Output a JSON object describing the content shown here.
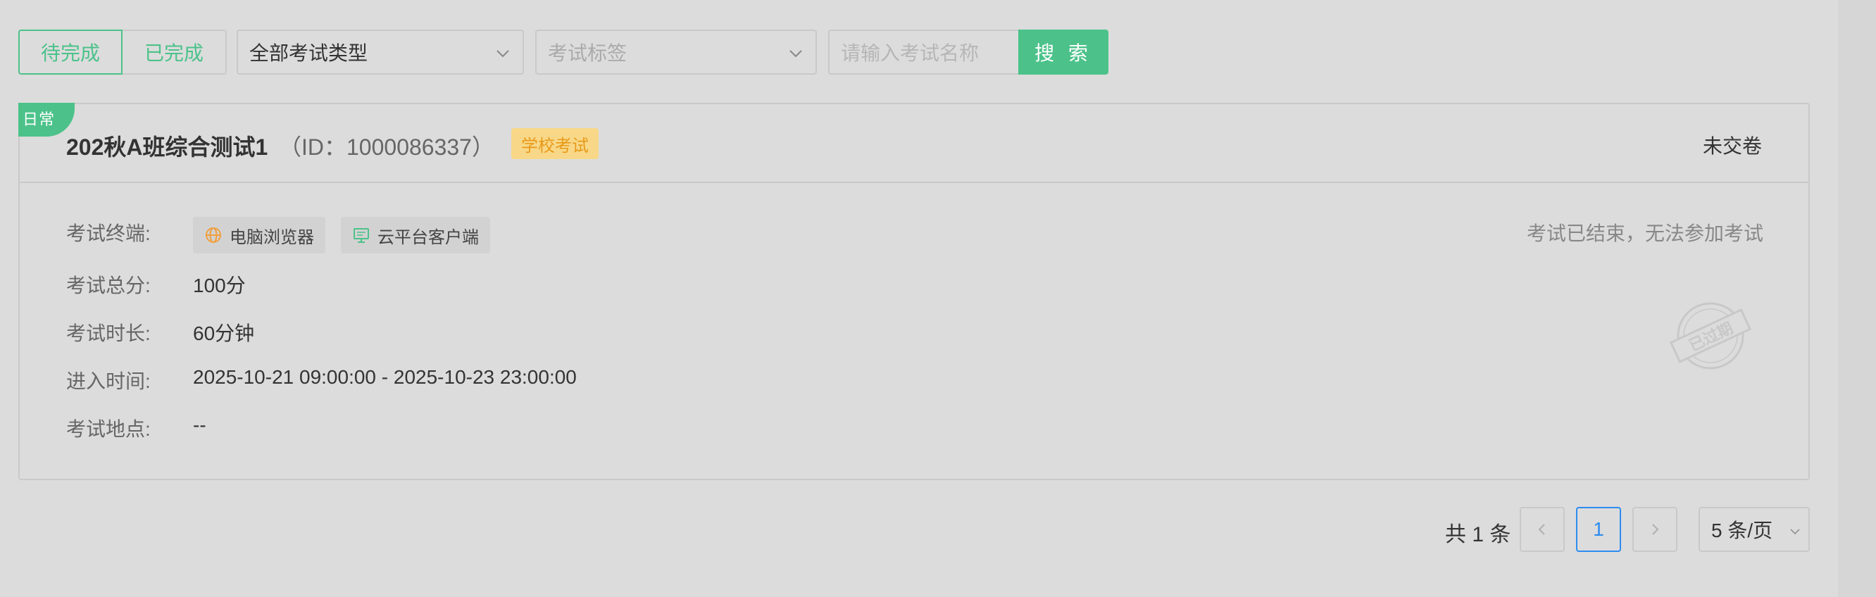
{
  "filters": {
    "tabs": [
      {
        "label": "待完成",
        "active": true
      },
      {
        "label": "已完成",
        "active": false
      }
    ],
    "exam_type": {
      "selected": "全部考试类型"
    },
    "exam_tag": {
      "placeholder": "考试标签"
    },
    "search": {
      "placeholder": "请输入考试名称",
      "button_label": "搜 索"
    }
  },
  "exam": {
    "ribbon": "日常",
    "title": "202秋A班综合测试1",
    "id_text": "（ID：1000086337）",
    "tag": "学校考试",
    "status": "未交卷",
    "fields": {
      "terminal_label": "考试终端:",
      "terminals": [
        "电脑浏览器",
        "云平台客户端"
      ],
      "score_label": "考试总分:",
      "score_value": "100分",
      "duration_label": "考试时长:",
      "duration_value": "60分钟",
      "entry_label": "进入时间:",
      "entry_value": "2025-10-21 09:00:00 - 2025-10-23 23:00:00",
      "location_label": "考试地点:",
      "location_value": "--"
    },
    "ended_message": "考试已结束，无法参加考试",
    "stamp_text": "已过期"
  },
  "pagination": {
    "total": "共 1 条",
    "current_page": "1",
    "page_size": "5 条/页"
  },
  "colors": {
    "primary_green": "#4cc28a",
    "tag_bg": "#f8d888",
    "tag_text": "#e89a1a",
    "current_page": "#2d8cf0"
  }
}
